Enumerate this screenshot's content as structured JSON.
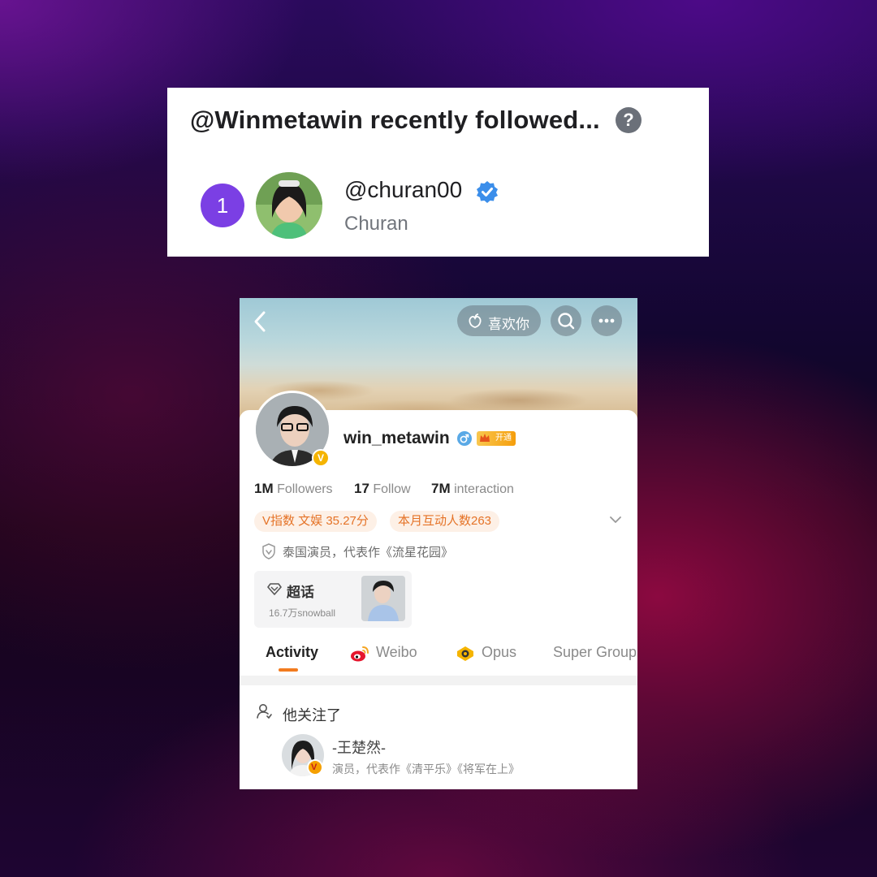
{
  "card1": {
    "title": "@Winmetawin recently followed...",
    "help_icon": "question-circle-icon",
    "rank": "1",
    "handle": "@churan00",
    "name": "Churan",
    "verified_icon": "verified-badge-icon",
    "accent": "#7b3fe4"
  },
  "weibo": {
    "header": {
      "back_icon": "chevron-left-icon",
      "like_label": "喜欢你",
      "like_icon": "peach-icon",
      "search_icon": "search-icon",
      "more_icon": "more-dots-icon"
    },
    "profile": {
      "username": "win_metawin",
      "gender_icon": "male-icon",
      "vip_label": "开通",
      "verified_badge": "V",
      "stats": [
        {
          "value": "1M",
          "label": "Followers"
        },
        {
          "value": "17",
          "label": "Follow"
        },
        {
          "value": "7M",
          "label": "interaction"
        }
      ],
      "tags": [
        "V指数 文娱 35.27分",
        "本月互动人数263"
      ],
      "bio": "泰国演员，代表作《流星花园》"
    },
    "super_topic": {
      "title": "超话",
      "subtitle": "16.7万snowball"
    },
    "tabs": [
      {
        "label": "Activity",
        "active": true
      },
      {
        "label": "Weibo",
        "icon": "weibo-icon"
      },
      {
        "label": "Opus",
        "icon": "opus-icon"
      },
      {
        "label": "Super Group"
      }
    ],
    "following": {
      "label": "他关注了",
      "name": "-王楚然-",
      "bio": "演员，代表作《清平乐》《将军在上》"
    },
    "accent": "#f27b1f"
  }
}
